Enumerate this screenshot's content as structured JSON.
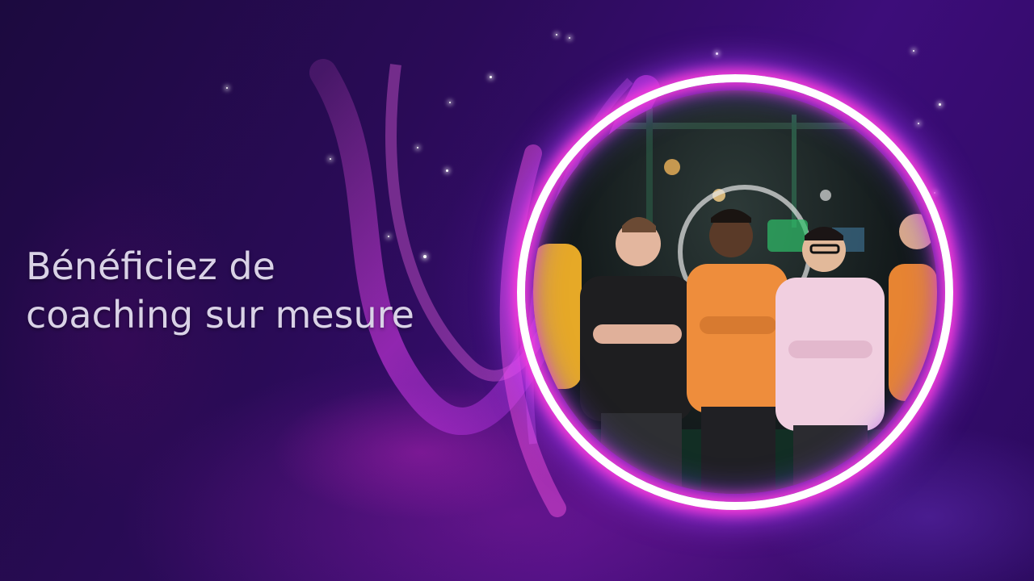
{
  "slide": {
    "headline_line1": "Bénéficiez de",
    "headline_line2": "coaching sur mesure",
    "photo_subject": "group of five people in a studio with crossed arms",
    "colors": {
      "background": "#2a0b57",
      "ring_glow": "#ff3bd6",
      "ring_core": "#ffffff",
      "text": "#d9d2e6"
    }
  }
}
